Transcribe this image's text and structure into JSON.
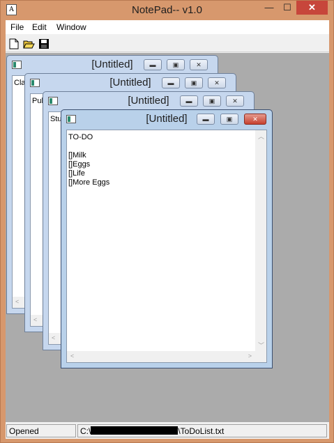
{
  "app": {
    "title": "NotePad-- v1.0",
    "icon_letter": "A",
    "controls": {
      "minimize": "—",
      "maximize": "☐",
      "close": "✕"
    }
  },
  "menu": {
    "file": "File",
    "edit": "Edit",
    "window": "Window"
  },
  "toolbar": {
    "new_icon": "new-document-icon",
    "open_icon": "open-folder-icon",
    "save_icon": "save-disk-icon"
  },
  "windows": [
    {
      "title": "[Untitled]",
      "content_preview": "Cla"
    },
    {
      "title": "[Untitled]",
      "content_preview": "Pub"
    },
    {
      "title": "[Untitled]",
      "content_preview": "Stu"
    },
    {
      "title": "[Untitled]",
      "content": "TO-DO\n\n[]Milk\n[]Eggs\n[]Life\n[]More Eggs"
    }
  ],
  "child_controls": {
    "minimize": "▬",
    "maximize": "▣",
    "close": "✕"
  },
  "status": {
    "left": "Opened",
    "path_prefix": "C:\\",
    "path_suffix": "\\ToDoList.txt"
  }
}
